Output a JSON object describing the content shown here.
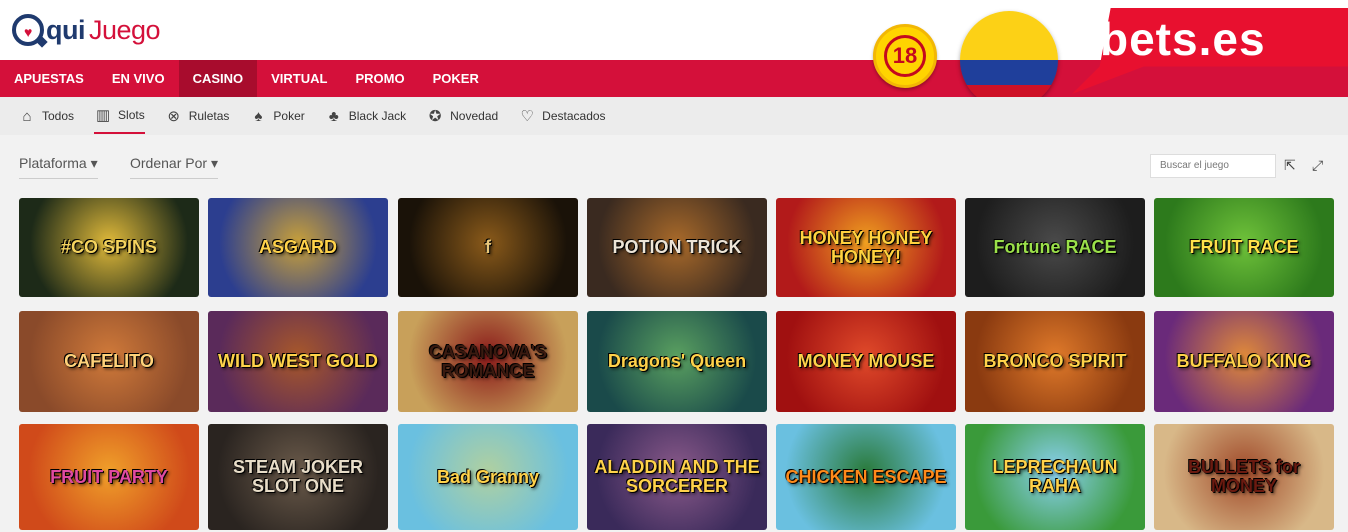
{
  "logo": {
    "part1": "qui",
    "part2": "Juego"
  },
  "nav": [
    {
      "label": "APUESTAS",
      "active": false
    },
    {
      "label": "EN VIVO",
      "active": false
    },
    {
      "label": "CASINO",
      "active": true
    },
    {
      "label": "VIRTUAL",
      "active": false
    },
    {
      "label": "PROMO",
      "active": false
    },
    {
      "label": "POKER",
      "active": false
    }
  ],
  "badges": {
    "age": "18",
    "brand": "bets.es"
  },
  "subnav": [
    {
      "label": "Todos",
      "icon": "house-icon",
      "glyph": "⌂"
    },
    {
      "label": "Slots",
      "icon": "slot-machine-icon",
      "glyph": "▥",
      "active": true
    },
    {
      "label": "Ruletas",
      "icon": "roulette-icon",
      "glyph": "⊗"
    },
    {
      "label": "Poker",
      "icon": "cards-icon",
      "glyph": "♠"
    },
    {
      "label": "Black Jack",
      "icon": "blackjack-icon",
      "glyph": "♣"
    },
    {
      "label": "Novedad",
      "icon": "new-icon",
      "glyph": "✪"
    },
    {
      "label": "Destacados",
      "icon": "thumb-up-icon",
      "glyph": "♡"
    }
  ],
  "filters": {
    "platform": "Plataforma",
    "order": "Ordenar Por",
    "search_placeholder": "Buscar el juego"
  },
  "games": [
    {
      "title": "#CO SPINS",
      "bg": "#1d2a18",
      "accent": "#e0b93a",
      "fg": "#f4d35e"
    },
    {
      "title": "ASGARD",
      "bg": "#2c3e8f",
      "accent": "#c8a03a",
      "fg": "#ffd24a"
    },
    {
      "title": "f",
      "bg": "#1a1208",
      "accent": "#8a5a1a",
      "fg": "#e8c77a"
    },
    {
      "title": "POTION TRICK",
      "bg": "#3a2a20",
      "accent": "#a96a2a",
      "fg": "#ece4d6"
    },
    {
      "title": "HONEY HONEY HONEY!",
      "bg": "#b21a1a",
      "accent": "#f0a020",
      "fg": "#ffd23f"
    },
    {
      "title": "Fortune RACE",
      "bg": "#1d1d1d",
      "accent": "#4a4a4a",
      "fg": "#9be04a"
    },
    {
      "title": "FRUIT RACE",
      "bg": "#2d7a1c",
      "accent": "#6fc23a",
      "fg": "#ffe14a"
    },
    {
      "title": "CAFELITO",
      "bg": "#8a4a2a",
      "accent": "#d07a3a",
      "fg": "#ffd27a"
    },
    {
      "title": "WILD WEST GOLD",
      "bg": "#5a2a5a",
      "accent": "#a8582a",
      "fg": "#ffd24a"
    },
    {
      "title": "CASANOVA'S ROMANCE",
      "bg": "#c8a05a",
      "accent": "#8a1a1a",
      "fg": "#3a1a10"
    },
    {
      "title": "Dragons' Queen",
      "bg": "#1a4a4a",
      "accent": "#5aa060",
      "fg": "#ffd24a"
    },
    {
      "title": "MONEY MOUSE",
      "bg": "#a01010",
      "accent": "#e04a2a",
      "fg": "#ffd24a"
    },
    {
      "title": "BRONCO SPIRIT",
      "bg": "#8a3a10",
      "accent": "#e07a2a",
      "fg": "#ffd24a"
    },
    {
      "title": "BUFFALO KING",
      "bg": "#6a2a7a",
      "accent": "#e08a3a",
      "fg": "#ffd24a"
    },
    {
      "title": "FRUIT PARTY",
      "bg": "#d04a1a",
      "accent": "#f0a02a",
      "fg": "#e04aa0"
    },
    {
      "title": "STEAM JOKER SLOT ONE",
      "bg": "#2a2420",
      "accent": "#6a5a4a",
      "fg": "#e8ddc8"
    },
    {
      "title": "Bad Granny",
      "bg": "#6ac0e0",
      "accent": "#b0d0a0",
      "fg": "#ffd24a"
    },
    {
      "title": "ALADDIN AND THE SORCERER",
      "bg": "#3a2a5a",
      "accent": "#8a5a8a",
      "fg": "#ffd24a"
    },
    {
      "title": "CHICKEN ESCAPE",
      "bg": "#6ac0e0",
      "accent": "#2a7a3a",
      "fg": "#ff8a1a"
    },
    {
      "title": "LEPRECHAUN RAHA",
      "bg": "#3a9a3a",
      "accent": "#8ad0f0",
      "fg": "#ffd24a"
    },
    {
      "title": "BULLETS for MONEY",
      "bg": "#d8b888",
      "accent": "#a04a2a",
      "fg": "#6a1a10"
    }
  ]
}
